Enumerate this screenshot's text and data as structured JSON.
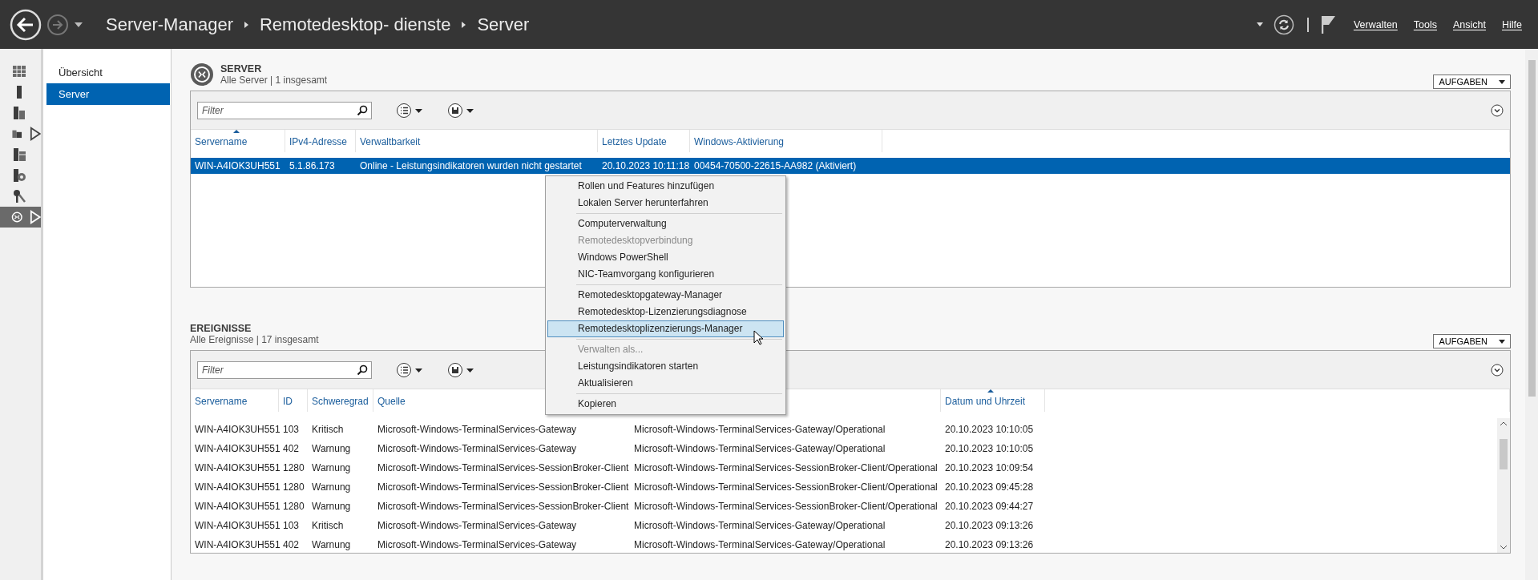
{
  "title_bar": {
    "breadcrumb": [
      "Server-Manager",
      "Remotedesktop- dienste",
      "Server"
    ],
    "menu": [
      "Verwalten",
      "Tools",
      "Ansicht",
      "Hilfe"
    ]
  },
  "icon_rail": [
    {
      "kind": "dashboard",
      "selected": false,
      "expandable": false
    },
    {
      "kind": "local-server",
      "selected": false,
      "expandable": false
    },
    {
      "kind": "all-servers",
      "selected": false,
      "expandable": false
    },
    {
      "kind": "file-services",
      "selected": false,
      "expandable": true
    },
    {
      "kind": "role-a",
      "selected": false,
      "expandable": false
    },
    {
      "kind": "role-globe",
      "selected": false,
      "expandable": false
    },
    {
      "kind": "role-key",
      "selected": false,
      "expandable": false
    },
    {
      "kind": "remote-desktop",
      "selected": true,
      "expandable": true
    }
  ],
  "nav": [
    {
      "label": "Übersicht",
      "selected": false
    },
    {
      "label": "Server",
      "selected": true
    }
  ],
  "server_section": {
    "title": "SERVER",
    "subtitle": "Alle Server | 1 insgesamt",
    "tasks_button": "AUFGABEN",
    "filter": {
      "placeholder": "Filter"
    },
    "columns": [
      {
        "label": "Servername",
        "sorted": true
      },
      {
        "label": "IPv4-Adresse",
        "sorted": false
      },
      {
        "label": "Verwaltbarkeit",
        "sorted": false
      },
      {
        "label": "Letztes Update",
        "sorted": false
      },
      {
        "label": "Windows-Aktivierung",
        "sorted": false
      }
    ],
    "rows": [
      {
        "selected": true,
        "cells": [
          "WIN-A4IOK3UH551",
          "5.1.86.173",
          "Online - Leistungsindikatoren wurden nicht gestartet",
          "20.10.2023 10:11:18",
          "00454-70500-22615-AA982 (Aktiviert)"
        ]
      }
    ]
  },
  "events_section": {
    "title": "EREIGNISSE",
    "subtitle": "Alle Ereignisse | 17 insgesamt",
    "tasks_button": "AUFGABEN",
    "filter": {
      "placeholder": "Filter"
    },
    "columns": [
      {
        "label": "Servername",
        "sorted": false
      },
      {
        "label": "ID",
        "sorted": false
      },
      {
        "label": "Schweregrad",
        "sorted": false
      },
      {
        "label": "Quelle",
        "sorted": false
      },
      {},
      {
        "label": "Datum und Uhrzeit",
        "sorted": true
      }
    ],
    "rows": [
      {
        "selected": false,
        "cells": [
          "WIN-A4IOK3UH551",
          "103",
          "Kritisch",
          "Microsoft-Windows-TerminalServices-Gateway",
          "Microsoft-Windows-TerminalServices-Gateway/Operational",
          "20.10.2023 10:10:05"
        ]
      },
      {
        "selected": false,
        "cells": [
          "WIN-A4IOK3UH551",
          "402",
          "Warnung",
          "Microsoft-Windows-TerminalServices-Gateway",
          "Microsoft-Windows-TerminalServices-Gateway/Operational",
          "20.10.2023 10:10:05"
        ]
      },
      {
        "selected": false,
        "cells": [
          "WIN-A4IOK3UH551",
          "1280",
          "Warnung",
          "Microsoft-Windows-TerminalServices-SessionBroker-Client",
          "Microsoft-Windows-TerminalServices-SessionBroker-Client/Operational",
          "20.10.2023 10:09:54"
        ]
      },
      {
        "selected": false,
        "cells": [
          "WIN-A4IOK3UH551",
          "1280",
          "Warnung",
          "Microsoft-Windows-TerminalServices-SessionBroker-Client",
          "Microsoft-Windows-TerminalServices-SessionBroker-Client/Operational",
          "20.10.2023 09:45:28"
        ]
      },
      {
        "selected": false,
        "cells": [
          "WIN-A4IOK3UH551",
          "1280",
          "Warnung",
          "Microsoft-Windows-TerminalServices-SessionBroker-Client",
          "Microsoft-Windows-TerminalServices-SessionBroker-Client/Operational",
          "20.10.2023 09:44:27"
        ]
      },
      {
        "selected": false,
        "cells": [
          "WIN-A4IOK3UH551",
          "103",
          "Kritisch",
          "Microsoft-Windows-TerminalServices-Gateway",
          "Microsoft-Windows-TerminalServices-Gateway/Operational",
          "20.10.2023 09:13:26"
        ]
      },
      {
        "selected": false,
        "cells": [
          "WIN-A4IOK3UH551",
          "402",
          "Warnung",
          "Microsoft-Windows-TerminalServices-Gateway",
          "Microsoft-Windows-TerminalServices-Gateway/Operational",
          "20.10.2023 09:13:26"
        ]
      }
    ]
  },
  "context_menu": [
    {
      "kind": "item",
      "label": "Rollen und Features hinzufügen",
      "disabled": false,
      "highlighted": false
    },
    {
      "kind": "item",
      "label": "Lokalen Server herunterfahren",
      "disabled": false,
      "highlighted": false
    },
    {
      "kind": "separator"
    },
    {
      "kind": "item",
      "label": "Computerverwaltung",
      "disabled": false,
      "highlighted": false
    },
    {
      "kind": "item",
      "label": "Remotedesktopverbindung",
      "disabled": true,
      "highlighted": false
    },
    {
      "kind": "item",
      "label": "Windows PowerShell",
      "disabled": false,
      "highlighted": false
    },
    {
      "kind": "item",
      "label": "NIC-Teamvorgang konfigurieren",
      "disabled": false,
      "highlighted": false
    },
    {
      "kind": "separator"
    },
    {
      "kind": "item",
      "label": "Remotedesktopgateway-Manager",
      "disabled": false,
      "highlighted": false
    },
    {
      "kind": "item",
      "label": "Remotedesktop-Lizenzierungsdiagnose",
      "disabled": false,
      "highlighted": false
    },
    {
      "kind": "item",
      "label": "Remotedesktoplizenzierungs-Manager",
      "disabled": false,
      "highlighted": true
    },
    {
      "kind": "separator"
    },
    {
      "kind": "item",
      "label": "Verwalten als...",
      "disabled": true,
      "highlighted": false
    },
    {
      "kind": "item",
      "label": "Leistungsindikatoren starten",
      "disabled": false,
      "highlighted": false
    },
    {
      "kind": "item",
      "label": "Aktualisieren",
      "disabled": false,
      "highlighted": false
    },
    {
      "kind": "separator"
    },
    {
      "kind": "item",
      "label": "Kopieren",
      "disabled": false,
      "highlighted": false
    }
  ]
}
